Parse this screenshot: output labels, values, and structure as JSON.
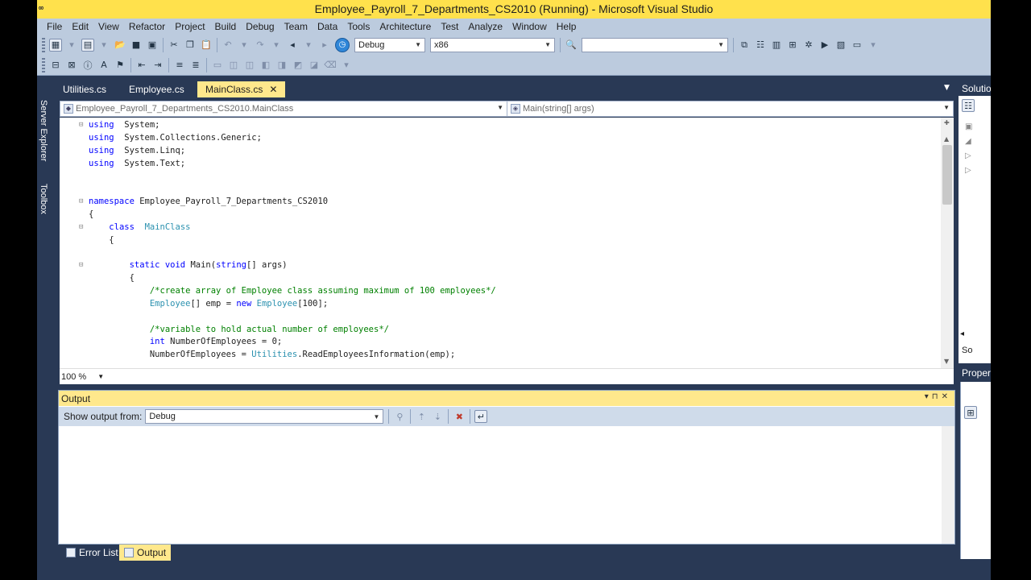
{
  "window": {
    "title": "Employee_Payroll_7_Departments_CS2010 (Running) - Microsoft Visual Studio",
    "app_icon": "∞"
  },
  "menu": [
    "File",
    "Edit",
    "View",
    "Refactor",
    "Project",
    "Build",
    "Debug",
    "Team",
    "Data",
    "Tools",
    "Architecture",
    "Test",
    "Analyze",
    "Window",
    "Help"
  ],
  "toolbar": {
    "configuration": "Debug",
    "platform": "x86",
    "find_value": ""
  },
  "side_tabs": [
    "Server Explorer",
    "Toolbox"
  ],
  "editor": {
    "tabs": [
      {
        "label": "Utilities.cs",
        "active": false
      },
      {
        "label": "Employee.cs",
        "active": false
      },
      {
        "label": "MainClass.cs",
        "active": true
      }
    ],
    "type_nav": "Employee_Payroll_7_Departments_CS2010.MainClass",
    "member_nav": "Main(string[] args)",
    "zoom": "100 %"
  },
  "output": {
    "title": "Output",
    "show_from_label": "Show output from:",
    "show_from_value": "Debug"
  },
  "bottom_tabs": [
    {
      "label": "Error List",
      "active": false
    },
    {
      "label": "Output",
      "active": true
    }
  ],
  "right_panels": {
    "solution_title": "Solution Explorer",
    "solution_footer": "So",
    "properties_title": "Properties"
  },
  "colors": {
    "title_bar": "#ffe14c",
    "chrome": "#293955",
    "menu_bg": "#bccbde",
    "active_tab": "#ffe88c",
    "keyword": "#0000ff",
    "class_name": "#2b91af",
    "comment": "#008000"
  }
}
